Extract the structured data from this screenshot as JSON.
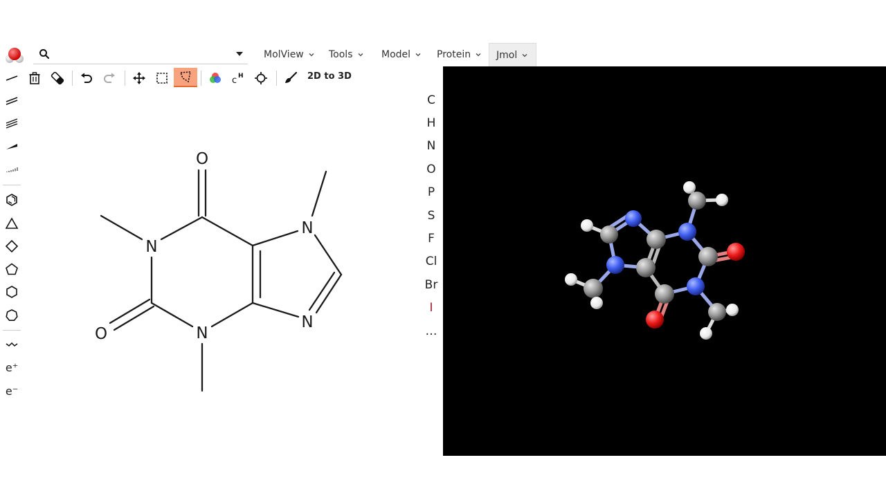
{
  "search": {
    "placeholder": ""
  },
  "menus": [
    {
      "label": "MolView"
    },
    {
      "label": "Tools"
    },
    {
      "label": "Model"
    },
    {
      "label": "Protein"
    },
    {
      "label": "Jmol"
    }
  ],
  "sketch_toolbar": {
    "convert_label": "2D to 3D",
    "active_tool": "lasso"
  },
  "left_tools": {
    "charge_plus": "e⁺",
    "charge_minus": "e⁻"
  },
  "elements": [
    "C",
    "H",
    "N",
    "O",
    "P",
    "S",
    "F",
    "Cl",
    "Br",
    "I",
    "…"
  ],
  "molecule_2d": {
    "atom_labels": {
      "o_top": "O",
      "o_left": "O",
      "n1": "N",
      "n3": "N",
      "n7": "N",
      "n9": "N"
    }
  },
  "colors": {
    "accent_active": "#f8a37e",
    "viewer_bg": "#000000",
    "carbon": "#8a8a8a",
    "nitrogen": "#3f5ef0",
    "oxygen": "#ee1c1c",
    "hydrogen": "#ffffff",
    "iodine_label": "#a0202c"
  }
}
